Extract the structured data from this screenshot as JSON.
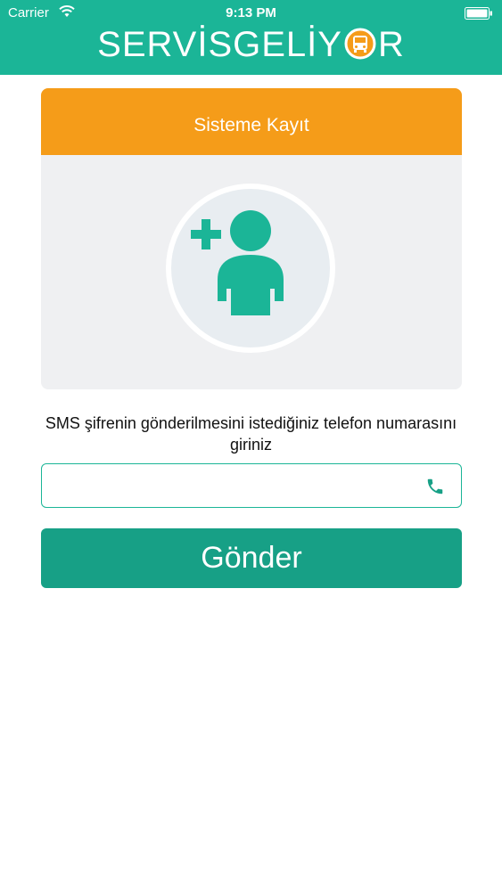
{
  "status_bar": {
    "carrier": "Carrier",
    "time": "9:13 PM"
  },
  "header": {
    "logo_left": "SERVİSGELİY",
    "logo_right": "R",
    "colors": {
      "header": "#1bb597",
      "bus_badge": "#f59c19"
    }
  },
  "card": {
    "title": "Sisteme Kayıt",
    "colors": {
      "title_bar": "#f59c19",
      "body": "#eff0f2"
    },
    "avatar_icon": "add-user-icon"
  },
  "form": {
    "instruction": "SMS şifrenin gönderilmesini istediğiniz telefon numarasını giriniz",
    "phone_value": "",
    "phone_placeholder": "",
    "phone_icon": "phone-icon",
    "submit_label": "Gönder",
    "colors": {
      "button": "#17a086",
      "field_border": "#1bb597"
    }
  }
}
